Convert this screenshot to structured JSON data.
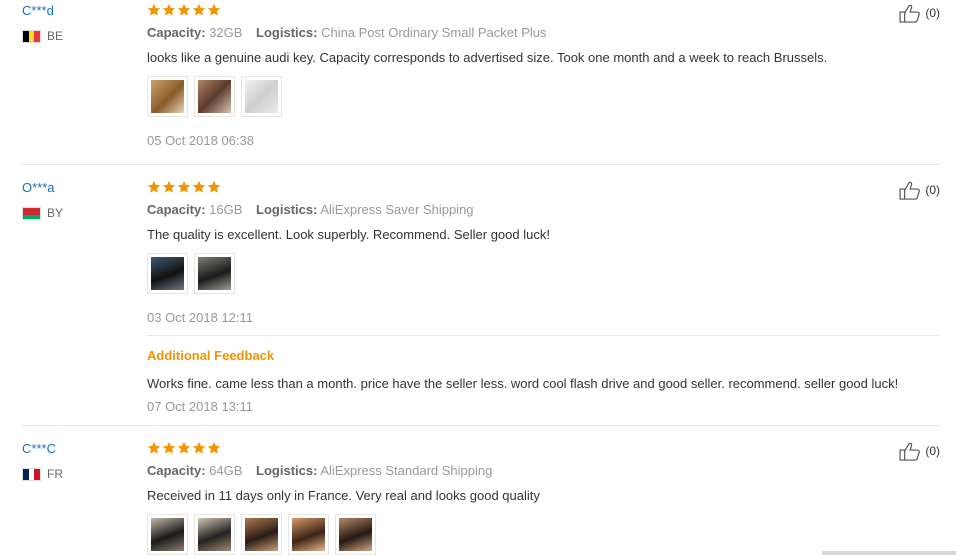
{
  "labels": {
    "capacity": "Capacity:",
    "logistics": "Logistics:"
  },
  "colors": {
    "star": "#f29400",
    "link": "#1a6ec1",
    "accent": "#f29400"
  },
  "reviews": [
    {
      "user": "C***d",
      "country": "BE",
      "rating": 5,
      "capacity": "32GB",
      "logistics": "China Post Ordinary Small Packet Plus",
      "text": "looks like a genuine audi key. Capacity corresponds to advertised size. Took one month and a week to reach Brussels.",
      "photo_count": 3,
      "date": "05 Oct 2018 06:38",
      "helpful": "(0)"
    },
    {
      "user": "O***a",
      "country": "BY",
      "rating": 5,
      "capacity": "16GB",
      "logistics": "AliExpress Saver Shipping",
      "text": "The quality is excellent. Look superbly. Recommend. Seller good luck!",
      "photo_count": 2,
      "date": "03 Oct 2018 12:11",
      "helpful": "(0)",
      "additional_feedback": {
        "title": "Additional Feedback",
        "text": "Works fine. came less than a month. price have the seller less. word cool flash drive and good seller. recommend. seller good luck!",
        "date": "07 Oct 2018 13:11"
      }
    },
    {
      "user": "C***C",
      "country": "FR",
      "rating": 5,
      "capacity": "64GB",
      "logistics": "AliExpress Standard Shipping",
      "text": "Received in 11 days only in France. Very real and looks good quality",
      "photo_count": 5,
      "helpful": "(0)"
    }
  ]
}
